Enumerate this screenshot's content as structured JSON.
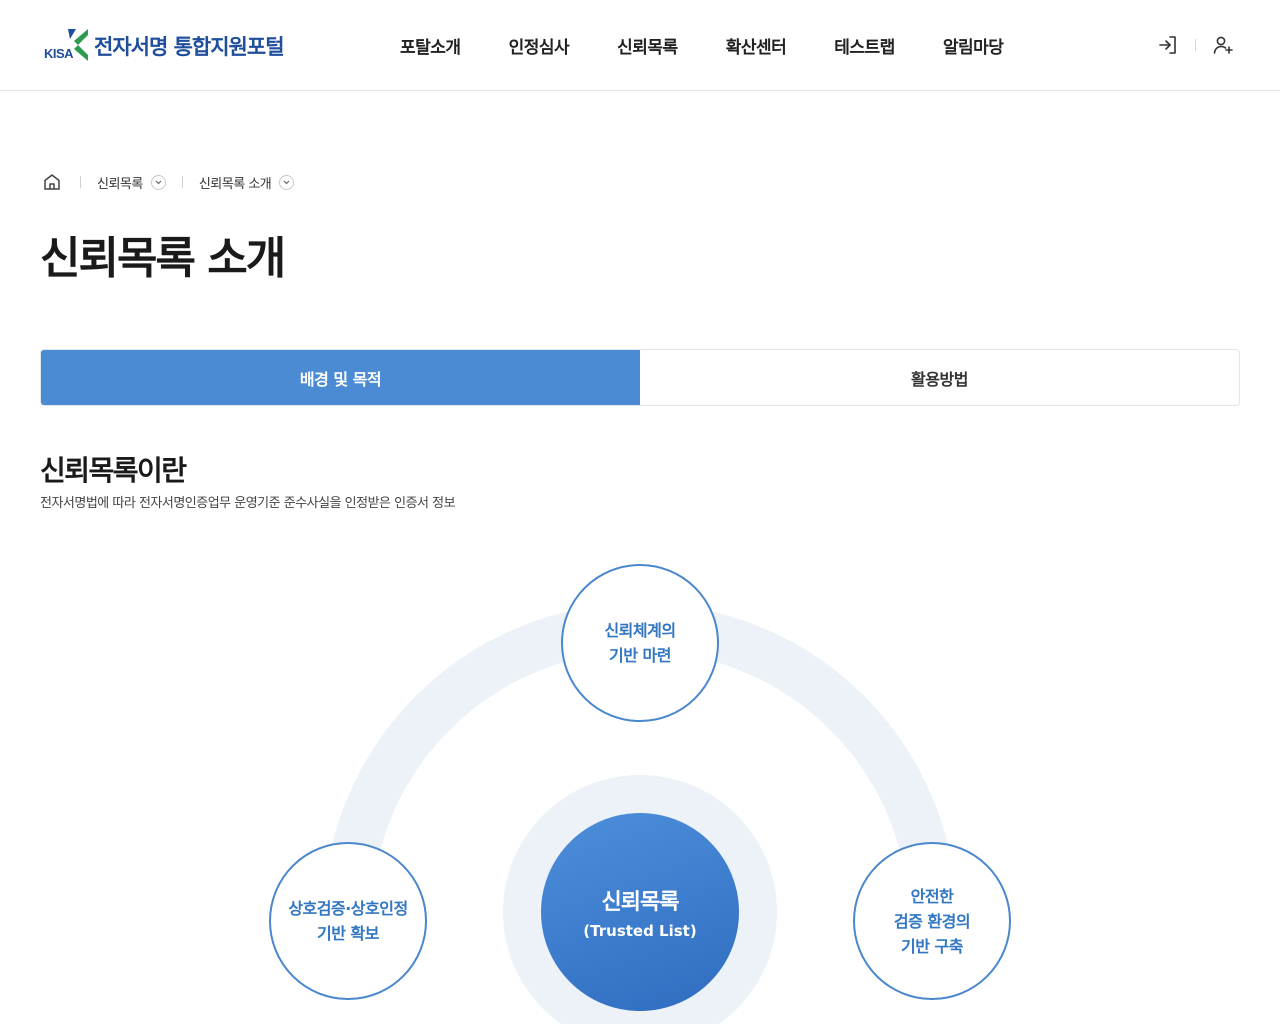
{
  "header": {
    "logo_kisa": "KISA",
    "logo_text": "전자서명 통합지원포털",
    "brand_color": "#1f4e9c",
    "nav": [
      {
        "label": "포탈소개"
      },
      {
        "label": "인정심사"
      },
      {
        "label": "신뢰목록"
      },
      {
        "label": "확산센터"
      },
      {
        "label": "테스트랩"
      },
      {
        "label": "알림마당"
      }
    ],
    "util_icons": [
      "login-icon",
      "user-add-icon"
    ]
  },
  "breadcrumb": {
    "home_icon": "home-icon",
    "items": [
      {
        "label": "신뢰목록"
      },
      {
        "label": "신뢰목록 소개"
      }
    ]
  },
  "page": {
    "title": "신뢰목록 소개"
  },
  "tabs": [
    {
      "label": "배경 및 목적",
      "active": true
    },
    {
      "label": "활용방법",
      "active": false
    }
  ],
  "section": {
    "title": "신뢰목록이란",
    "description": "전자서명법에 따라 전자서명인증업무 운영기준 준수사실을 인정받은 인증서 정보"
  },
  "diagram": {
    "accent_color": "#4a87cc",
    "center": {
      "title": "신뢰목록",
      "subtitle": "(Trusted List)"
    },
    "top": {
      "line1": "신뢰체계의",
      "line2": "기반 마련"
    },
    "left": {
      "line1": "상호검증·상호인정",
      "line2": "기반 확보"
    },
    "right": {
      "line1": "안전한",
      "line2": "검증 환경의",
      "line3": "기반 구축"
    }
  }
}
